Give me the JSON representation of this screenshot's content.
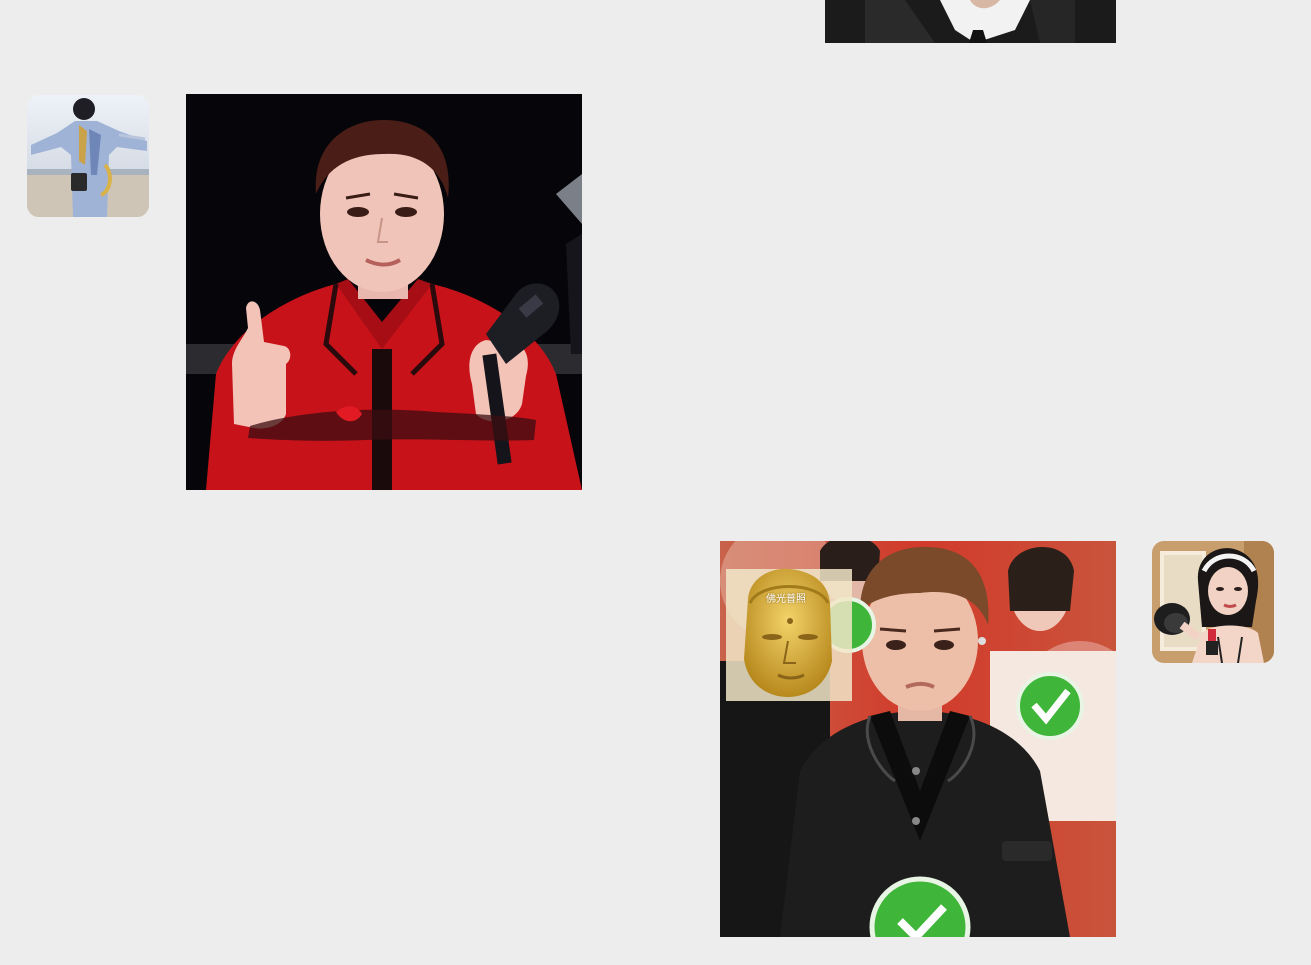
{
  "conversation": {
    "messages": [
      {
        "side": "right",
        "kind": "image",
        "content": "partial-suit-photo"
      },
      {
        "side": "left",
        "kind": "sticker",
        "content": "red-jacket-thumbs-up-sticker",
        "avatar": "beach-person-avatar"
      },
      {
        "side": "right",
        "kind": "sticker",
        "content": "leather-jacket-buddha-sticker",
        "avatar": "woman-headband-avatar",
        "overlay_text": "佛光普照"
      }
    ]
  },
  "colors": {
    "background": "#ededed",
    "red_jacket": "#c8121a",
    "stage_black": "#0a0a0c",
    "leather": "#1d1d1d",
    "gold": "#d9b23a",
    "green_badge": "#3fb53a"
  }
}
